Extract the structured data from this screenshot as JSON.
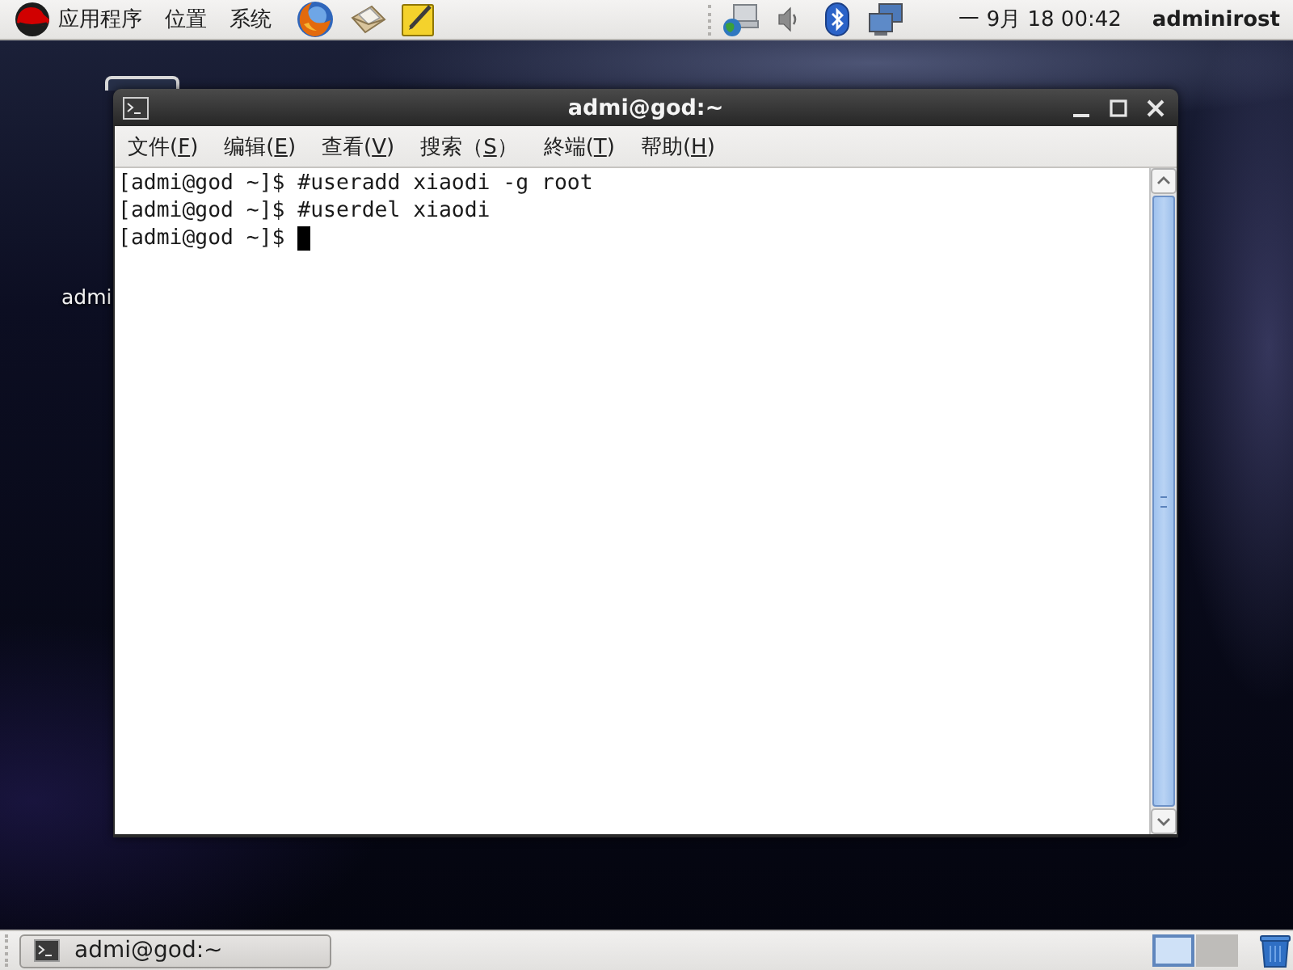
{
  "top_panel": {
    "menus": [
      "应用程序",
      "位置",
      "系统"
    ],
    "clock": "一 9月 18 00:42",
    "user": "adminirost"
  },
  "desktop": {
    "icons": [
      {
        "label": "admi"
      }
    ]
  },
  "window": {
    "title": "admi@god:~",
    "menu": [
      {
        "before": "文件(",
        "key": "F",
        "after": ")"
      },
      {
        "before": "编辑(",
        "key": "E",
        "after": ")"
      },
      {
        "before": "查看(",
        "key": "V",
        "after": ")"
      },
      {
        "before": "搜索（",
        "key": "S",
        "after": "）"
      },
      {
        "before": "終端(",
        "key": "T",
        "after": ")"
      },
      {
        "before": "帮助(",
        "key": "H",
        "after": ")"
      }
    ],
    "lines": [
      {
        "text": "[admi@god ~]$ #useradd xiaodi -g root",
        "cursor": false
      },
      {
        "text": "[admi@god ~]$ #userdel xiaodi",
        "cursor": false
      },
      {
        "text": "[admi@god ~]$",
        "cursor": true
      }
    ]
  },
  "bottom_panel": {
    "tasks": [
      {
        "label": "admi@god:~",
        "selected": false
      }
    ],
    "workspaces": [
      {
        "selected": true
      },
      {
        "selected": false
      }
    ]
  }
}
